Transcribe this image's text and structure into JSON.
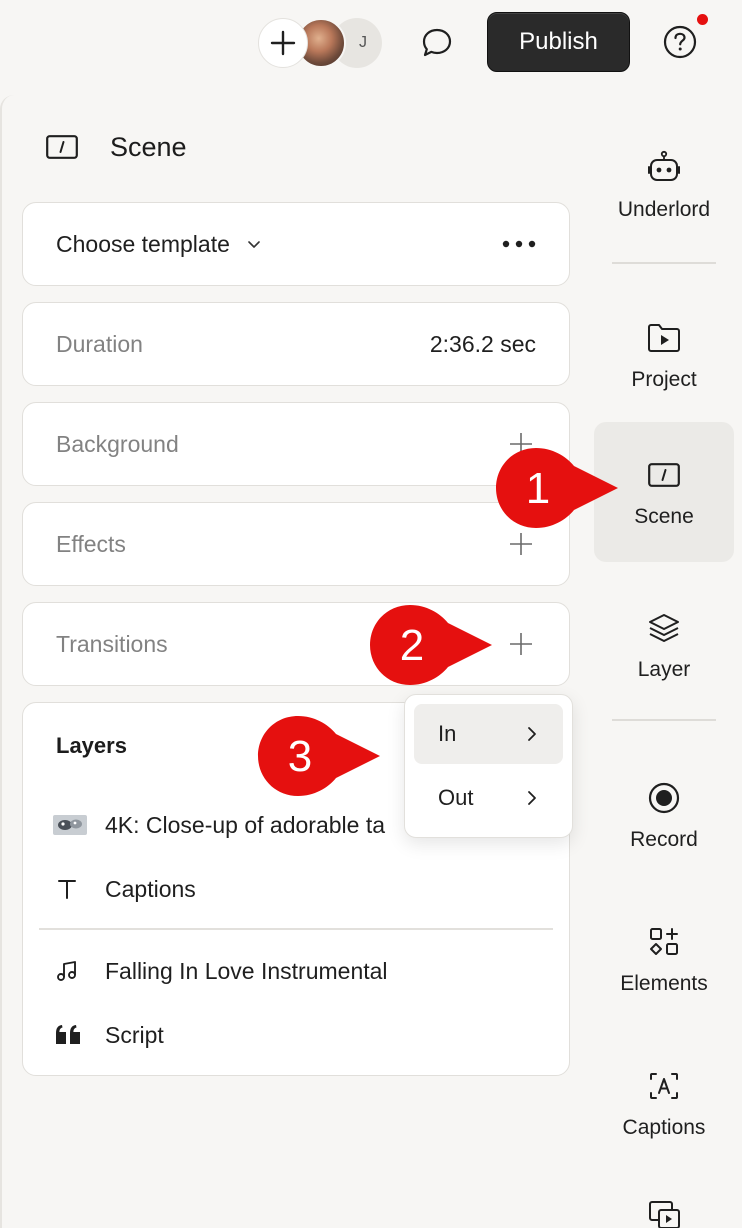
{
  "topbar": {
    "avatar_initial": "J",
    "publish_label": "Publish",
    "notification_color": "#e5100f"
  },
  "panel": {
    "title": "Scene",
    "template_label": "Choose template",
    "duration_label": "Duration",
    "duration_value": "2:36.2 sec",
    "background_label": "Background",
    "effects_label": "Effects",
    "transitions_label": "Transitions"
  },
  "layers": {
    "title": "Layers",
    "items": [
      {
        "icon": "video-thumbnail",
        "label": "4K: Close-up of adorable ta"
      },
      {
        "icon": "text-icon",
        "label": "Captions"
      }
    ],
    "audio_items": [
      {
        "icon": "music-note-icon",
        "label": "Falling In Love Instrumental"
      },
      {
        "icon": "quote-icon",
        "label": "Script"
      }
    ]
  },
  "transition_menu": {
    "items": [
      {
        "label": "In"
      },
      {
        "label": "Out"
      }
    ]
  },
  "sidebar": {
    "items": [
      {
        "label": "Underlord",
        "icon": "robot-icon"
      },
      {
        "label": "Project",
        "icon": "folder-play-icon"
      },
      {
        "label": "Scene",
        "icon": "scene-icon",
        "active": true
      },
      {
        "label": "Layer",
        "icon": "layers-icon"
      },
      {
        "label": "Record",
        "icon": "record-icon"
      },
      {
        "label": "Elements",
        "icon": "shapes-icon"
      },
      {
        "label": "Captions",
        "icon": "captions-icon"
      }
    ]
  },
  "annotations": {
    "markers": [
      "1",
      "2",
      "3"
    ],
    "color": "#e5100f"
  }
}
